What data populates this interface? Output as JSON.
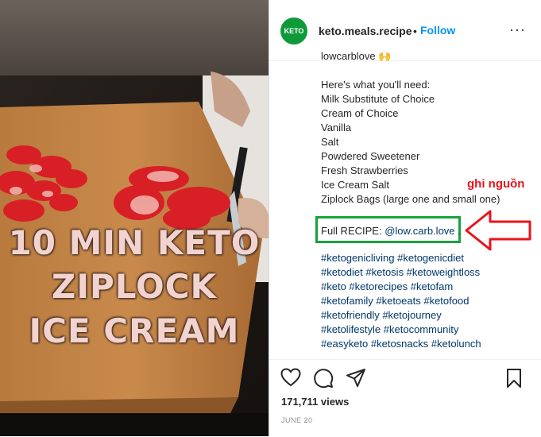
{
  "video": {
    "overlay_lines": [
      "10 MIN KETO",
      "ZIPLOCK",
      "ICE CREAM"
    ]
  },
  "post": {
    "avatar_text": "KETO",
    "username": "keto.meals.recipe",
    "separator": "•",
    "follow_label": "Follow",
    "more_label": "···"
  },
  "caption": {
    "partial_line": "lowcarblove 🙌",
    "lines": [
      "Here's what you'll need:",
      "Milk Substitute of Choice",
      "Cream of Choice",
      "Vanilla",
      "Salt",
      "Powdered Sweetener",
      "Fresh Strawberries",
      "Ice Cream Salt",
      "Ziplock Bags (large one and small one)"
    ],
    "recipe_prefix": "Full RECIPE: ",
    "recipe_mention": "@low.carb.love",
    "recipe_suffix": " .",
    "hashtag_lines": [
      "#ketogenicliving #ketogenicdiet",
      "#ketodiet #ketosis #ketoweightloss",
      "#keto #ketorecipes #ketofam",
      "#ketofamily #ketoeats #ketofood",
      "#ketofriendly #ketojourney",
      "#ketolifestyle #ketocommunity",
      "#easyketo #ketosnacks #ketolunch"
    ]
  },
  "annotation": {
    "label": "ghi nguồn",
    "color": "#e8141b"
  },
  "stats": {
    "views": "171,711 views",
    "date": "JUNE 20"
  },
  "colors": {
    "accent": "#0095f6",
    "box": "#19a23b",
    "hashtag": "#00376b"
  },
  "icons": [
    "heart-icon",
    "comment-icon",
    "share-icon",
    "bookmark-icon"
  ]
}
